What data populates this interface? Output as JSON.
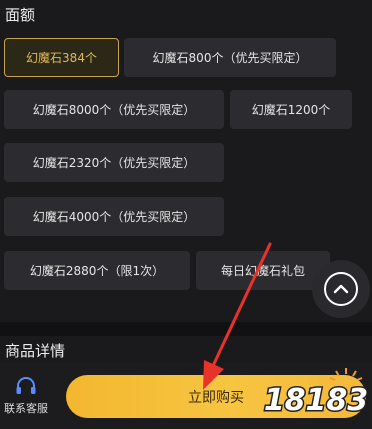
{
  "denomination": {
    "title": "面额",
    "options": [
      {
        "label": "幻魔石384个",
        "selected": true
      },
      {
        "label": "幻魔石800个（优先买限定）",
        "selected": false
      },
      {
        "label": "幻魔石8000个（优先买限定）",
        "selected": false
      },
      {
        "label": "幻魔石1200个",
        "selected": false
      },
      {
        "label": "幻魔石2320个（优先买限定）",
        "selected": false
      },
      {
        "label": "幻魔石4000个（优先买限定）",
        "selected": false
      },
      {
        "label": "幻魔石2880个（限1次）",
        "selected": false
      },
      {
        "label": "每日幻魔石礼包",
        "selected": false
      }
    ]
  },
  "product_details": {
    "title": "商品详情"
  },
  "bottom_bar": {
    "customer_service_label": "联系客服",
    "buy_label": "立即购买"
  },
  "watermark": {
    "text": "18183"
  },
  "icons": {
    "scroll_top": "chevron-up-icon",
    "customer_service": "headset-icon"
  },
  "colors": {
    "accent_gold": "#c9a24a",
    "buy_button": "#f7c541",
    "arrow": "#e8322a",
    "background": "#1a1a1d"
  }
}
